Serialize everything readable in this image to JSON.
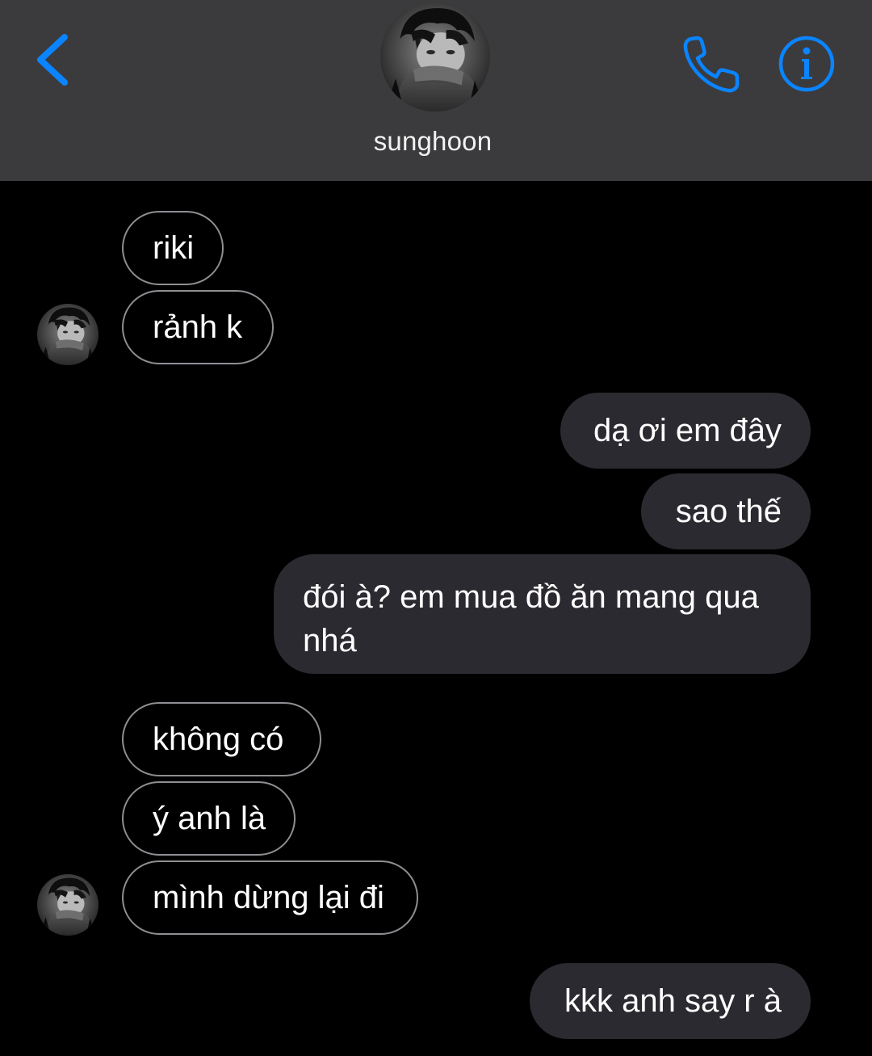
{
  "header": {
    "contact_name": "sunghoon",
    "back_icon": "chevron-left-icon",
    "call_icon": "phone-icon",
    "info_icon": "info-icon",
    "accent_color": "#0a84ff",
    "background_color": "#3b3b3d"
  },
  "conversation": {
    "messages": [
      {
        "sender": "contact",
        "text": "riki"
      },
      {
        "sender": "contact",
        "text": "rảnh k"
      },
      {
        "sender": "me",
        "text": "dạ ơi em đây"
      },
      {
        "sender": "me",
        "text": "sao thế"
      },
      {
        "sender": "me",
        "text": "đói à? em mua đồ ăn mang qua nhá"
      },
      {
        "sender": "contact",
        "text": "không có"
      },
      {
        "sender": "contact",
        "text": "ý anh là"
      },
      {
        "sender": "contact",
        "text": "mình dừng lại đi"
      },
      {
        "sender": "me",
        "text": "kkk anh say r à"
      }
    ],
    "outgoing_bubble_color": "#2b2a30",
    "incoming_bubble_border_color": "#8e8e93"
  }
}
